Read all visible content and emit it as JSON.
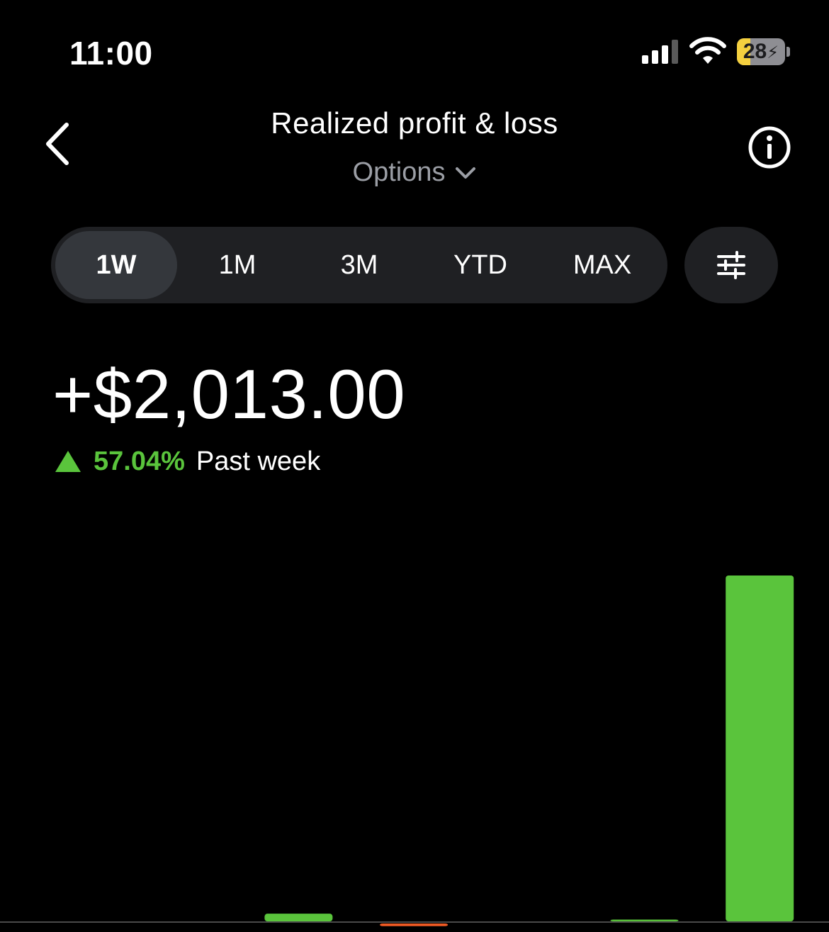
{
  "status_bar": {
    "time": "11:00",
    "battery_level": "28",
    "battery_fill_color": "#f4d03f",
    "icons": [
      "cellular-signal-icon",
      "wifi-icon",
      "battery-icon"
    ]
  },
  "header": {
    "title": "Realized profit & loss",
    "asset_selector": "Options",
    "back_icon": "chevron-left-icon",
    "info_icon": "info-circle-icon",
    "selector_icon": "chevron-down-icon"
  },
  "range_tabs": {
    "items": [
      "1W",
      "1M",
      "3M",
      "YTD",
      "MAX"
    ],
    "selected": "1W",
    "filter_icon": "sliders-icon"
  },
  "summary": {
    "total": "+$2,013.00",
    "percent": "57.04%",
    "period": "Past week",
    "direction_icon": "triangle-up-icon"
  },
  "colors": {
    "positive": "#5ac43c",
    "negative": "#ee5a24",
    "background": "#000000",
    "pill_background": "#1f2023",
    "pill_active": "#34373c"
  },
  "chart_data": {
    "type": "bar",
    "title": "",
    "xlabel": "",
    "ylabel": "",
    "grid": false,
    "axis_line": true,
    "categories": [
      "",
      "",
      "",
      "",
      "",
      "",
      ""
    ],
    "values": [
      0,
      0,
      43,
      -15,
      0,
      10,
      1939
    ]
  }
}
